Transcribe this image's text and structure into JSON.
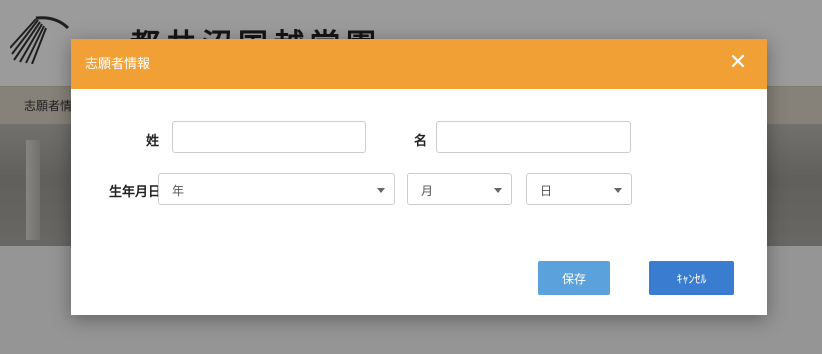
{
  "background": {
    "site_title": "都共沼国越堂園",
    "nav_item": "志願者情報"
  },
  "modal": {
    "title": "志願者情報",
    "close_icon": "close-icon",
    "header_color": "#f0a035",
    "fields": {
      "surname_label": "姓",
      "surname_value": "",
      "given_name_label": "名",
      "given_name_value": "",
      "birthdate_label": "生年月日",
      "year_selected": "年",
      "month_selected": "月",
      "day_selected": "日"
    },
    "buttons": {
      "save_label": "保存",
      "cancel_label": "ｷｬﾝｾﾙ"
    }
  }
}
